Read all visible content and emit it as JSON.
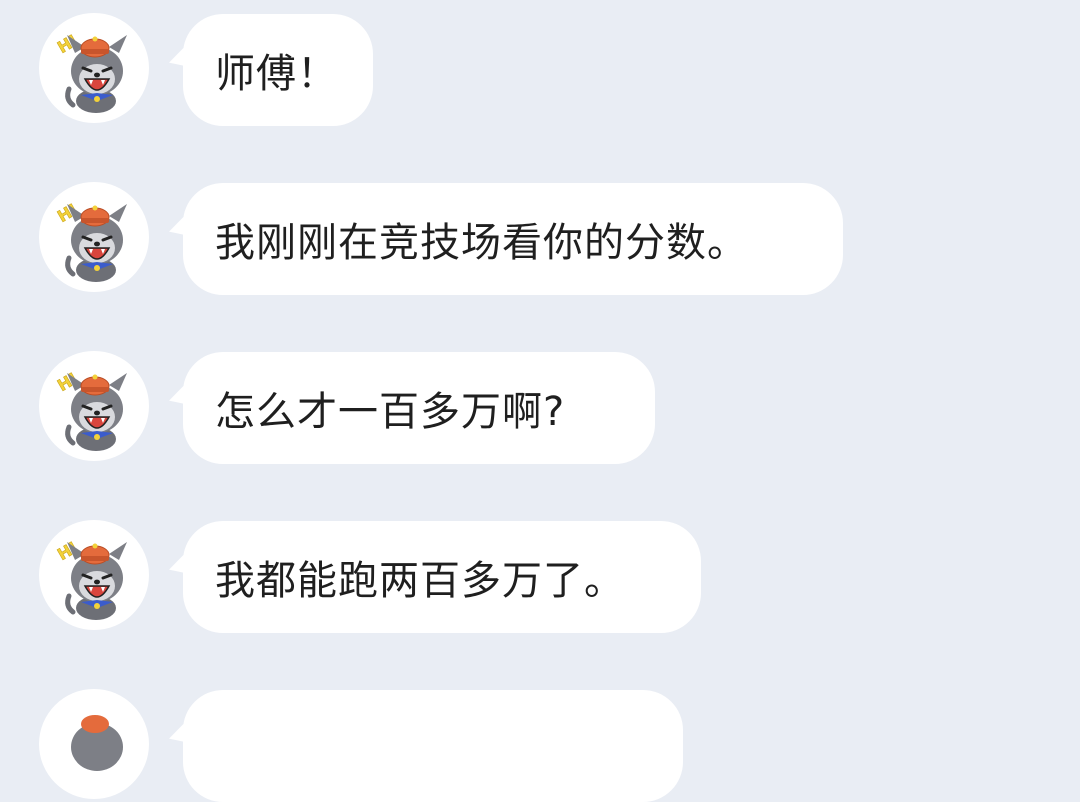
{
  "messages": [
    {
      "text": "师傅！"
    },
    {
      "text": "我刚刚在竞技场看你的分数。"
    },
    {
      "text": "怎么才一百多万啊?"
    },
    {
      "text": "我都能跑两百多万了。"
    },
    {
      "text": ""
    }
  ],
  "avatar": {
    "icon": "grey-wolf-avatar-icon",
    "hi_text": "HI",
    "colors": {
      "hi_yellow": "#f3d23a",
      "hat_red": "#e46b3c",
      "wolf_grey": "#7d7f86",
      "mouth": "#d9453d",
      "collar_blue": "#3b5ccc"
    }
  },
  "colors": {
    "background": "#e9edf4",
    "bubble": "#ffffff",
    "text": "#1f1f1f"
  }
}
